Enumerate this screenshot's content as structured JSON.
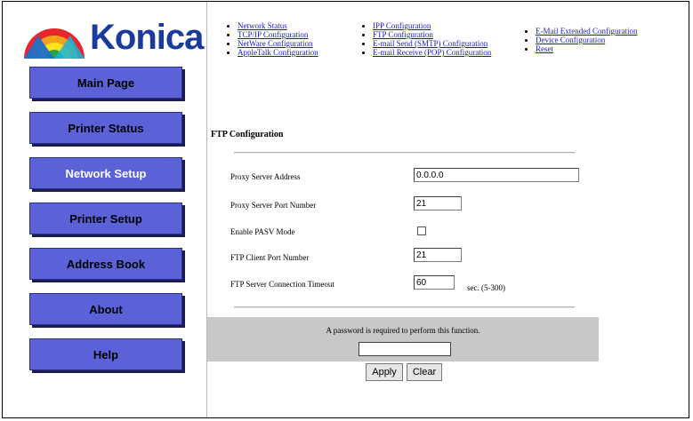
{
  "brand": {
    "name": "Konica"
  },
  "sidebar": {
    "items": [
      {
        "label": "Main Page"
      },
      {
        "label": "Printer Status"
      },
      {
        "label": "Network Setup"
      },
      {
        "label": "Printer Setup"
      },
      {
        "label": "Address Book"
      },
      {
        "label": "About"
      },
      {
        "label": "Help"
      }
    ]
  },
  "links": {
    "col1": [
      "Network Status",
      "TCP/IP Configuration",
      "NetWare Configuration",
      "AppleTalk Configuration"
    ],
    "col2": [
      "IPP Configuration",
      "FTP Configuration",
      "E-mail Send (SMTP) Configuration",
      "E-mail Receive (POP) Configuration"
    ],
    "col3": [
      "E-Mail Extended Configuration",
      "Device Configuration",
      "Reset"
    ]
  },
  "form": {
    "title": "FTP Configuration",
    "proxy_address_label": "Proxy Server Address",
    "proxy_address_value": "0.0.0.0",
    "proxy_port_label": "Proxy Server Port Number",
    "proxy_port_value": "21",
    "pasv_label": "Enable PASV Mode",
    "client_port_label": "FTP Client Port Number",
    "client_port_value": "21",
    "timeout_label": "FTP Server Connection Timeout",
    "timeout_value": "60",
    "timeout_unit": "sec. (5-300)"
  },
  "password": {
    "message": "A password is required to perform this function."
  },
  "actions": {
    "apply": "Apply",
    "clear": "Clear"
  },
  "colors": {
    "nav_button": "#5b62d8",
    "link": "#1a1acc",
    "logo_text": "#1a3a9c"
  }
}
